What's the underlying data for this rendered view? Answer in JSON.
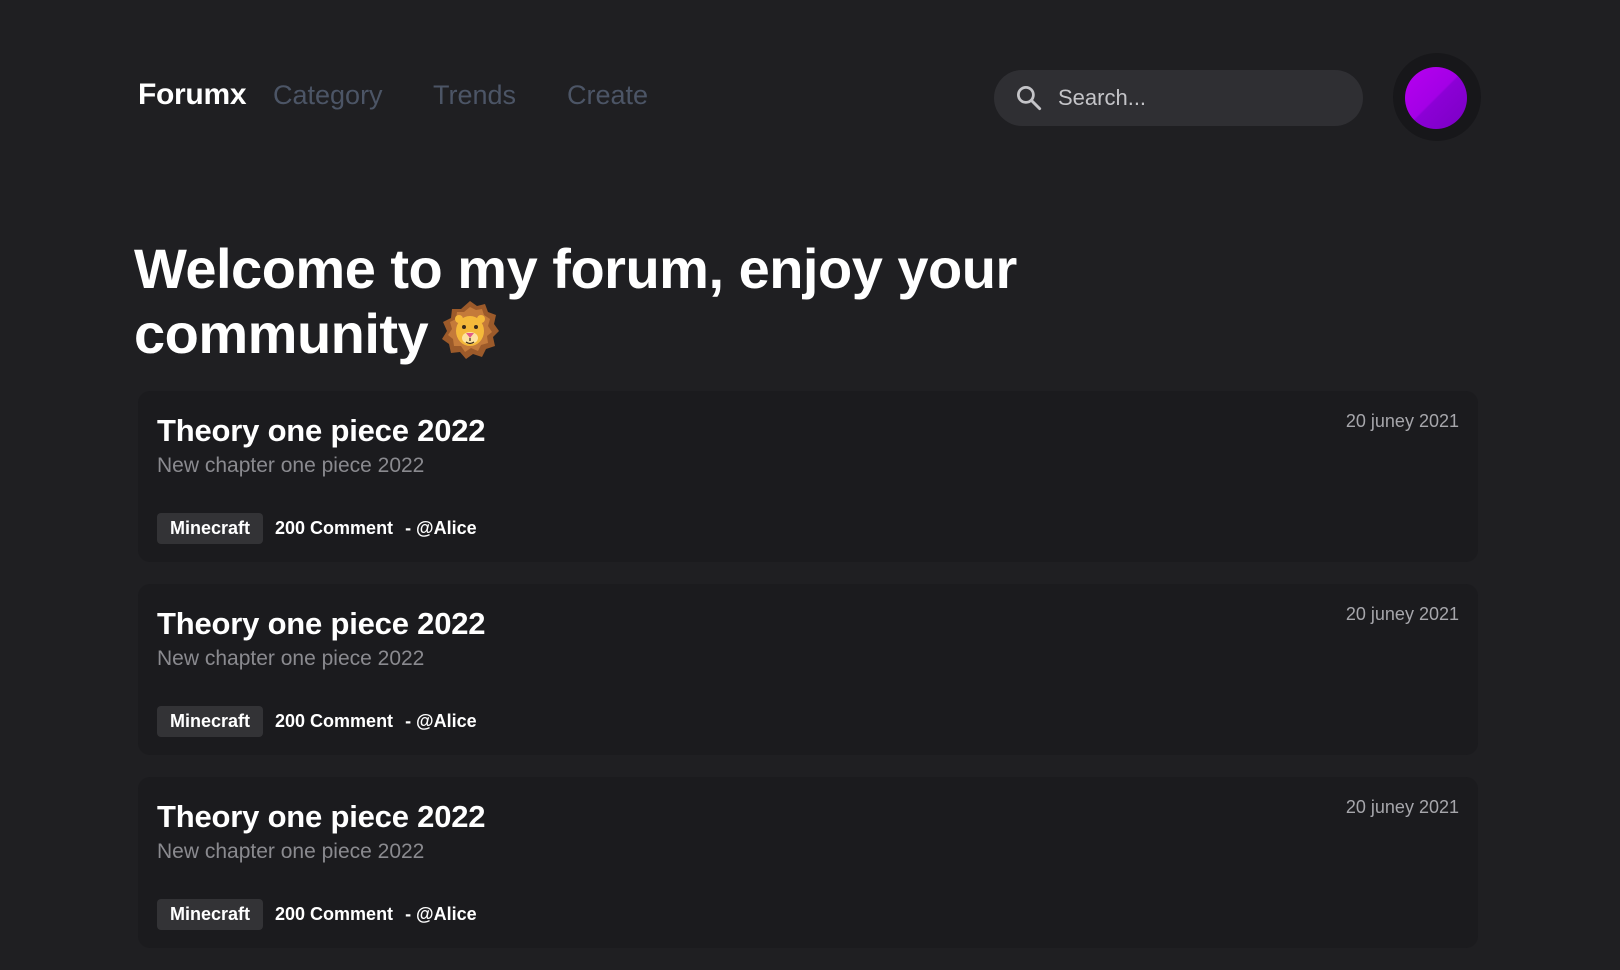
{
  "header": {
    "logo": "Forumx",
    "nav": [
      {
        "label": "Category"
      },
      {
        "label": "Trends"
      },
      {
        "label": "Create"
      }
    ],
    "search": {
      "placeholder": "Search...",
      "value": "",
      "icon": "search-icon"
    },
    "avatar": {
      "icon": "avatar",
      "color": "#a300e6"
    }
  },
  "hero": {
    "title": "Welcome to my forum, enjoy your community",
    "emoji_icon": "lion-icon"
  },
  "posts": [
    {
      "title": "Theory one piece 2022",
      "subtitle": "New chapter one piece 2022",
      "date": "20 juney 2021",
      "tag": "Minecraft",
      "comments": "200 Comment",
      "author": "- @Alice"
    },
    {
      "title": "Theory one piece 2022",
      "subtitle": "New chapter one piece 2022",
      "date": "20 juney 2021",
      "tag": "Minecraft",
      "comments": "200 Comment",
      "author": "- @Alice"
    },
    {
      "title": "Theory one piece 2022",
      "subtitle": "New chapter one piece 2022",
      "date": "20 juney 2021",
      "tag": "Minecraft",
      "comments": "200 Comment",
      "author": "- @Alice"
    }
  ],
  "colors": {
    "background": "#1f1f22",
    "card": "#1b1b1e",
    "nav_link": "#4c5566",
    "search_bg": "#2f2f33",
    "tag_bg": "#333336",
    "accent": "#a300e6"
  }
}
